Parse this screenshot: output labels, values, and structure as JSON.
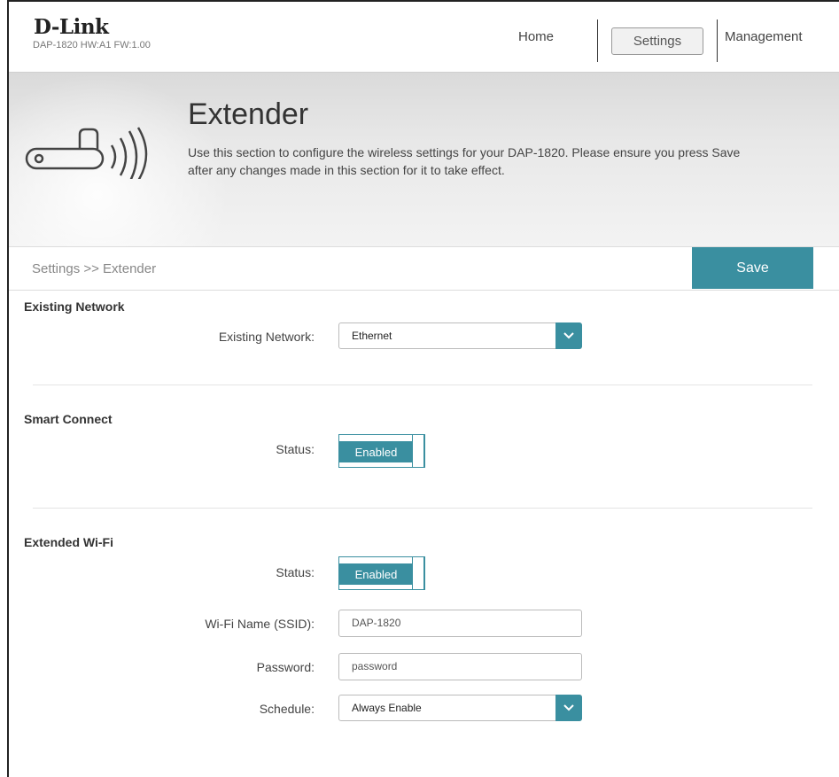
{
  "header": {
    "brand": "D-Link",
    "hw_info": "DAP-1820  HW:A1  FW:1.00",
    "nav": {
      "home": "Home",
      "settings": "Settings",
      "management": "Management"
    }
  },
  "banner": {
    "title": "Extender",
    "description": "Use this section to configure the wireless settings for your DAP-1820. Please ensure you press Save after any changes made in this section for it to take effect."
  },
  "breadcrumb": "Settings >> Extender",
  "save_label": "Save",
  "existing_network": {
    "title": "Existing Network",
    "label": "Existing Network:",
    "value": "Ethernet"
  },
  "smart_connect": {
    "title": "Smart Connect",
    "status_label": "Status:",
    "status_value": "Enabled"
  },
  "extended_wifi": {
    "title": "Extended Wi-Fi",
    "status_label": "Status:",
    "status_value": "Enabled",
    "ssid_label": "Wi-Fi Name (SSID):",
    "ssid_value": "DAP-1820",
    "password_label": "Password:",
    "password_value": "password",
    "schedule_label": "Schedule:",
    "schedule_value": "Always Enable"
  },
  "colors": {
    "accent": "#3a8fa0"
  }
}
